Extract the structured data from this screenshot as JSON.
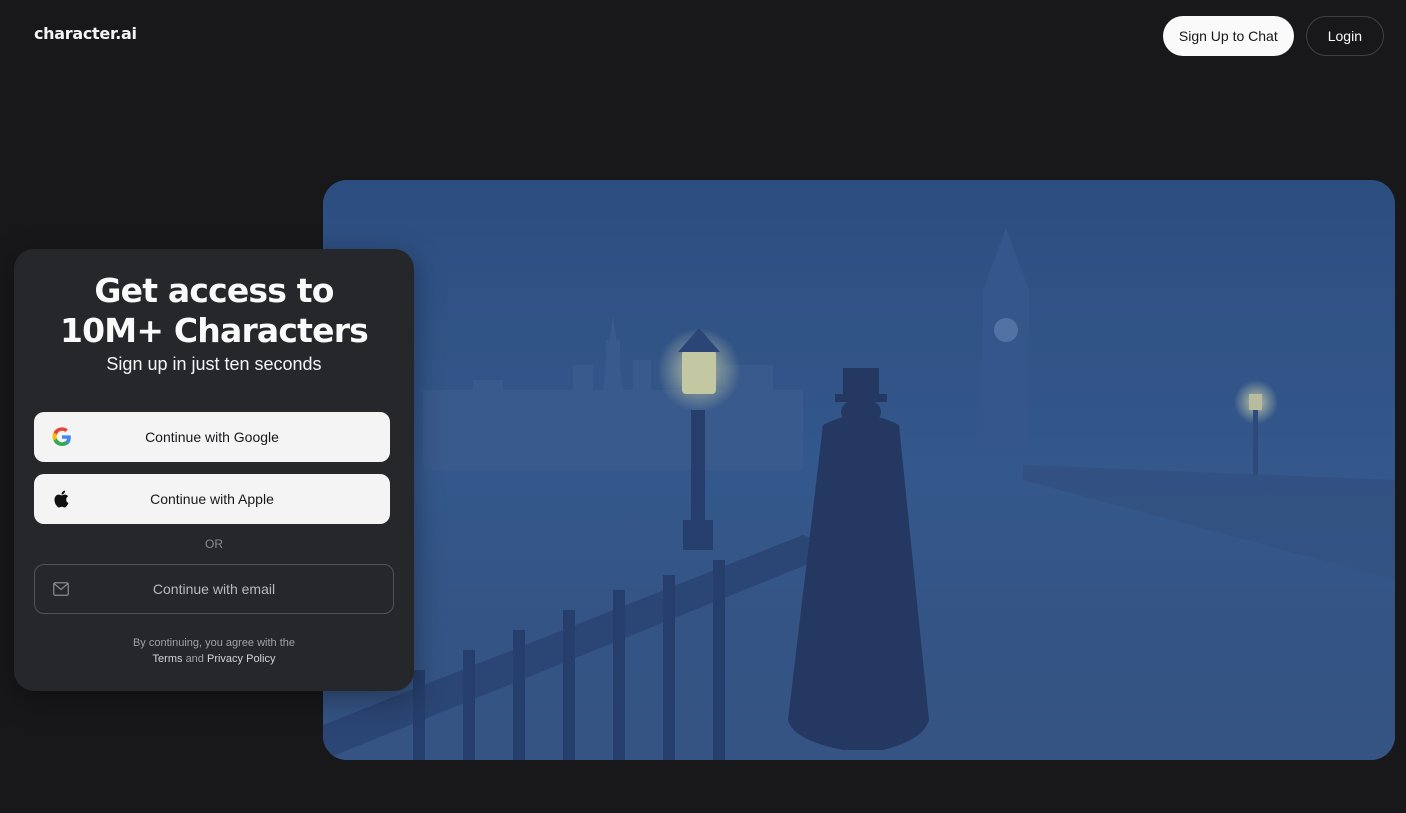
{
  "header": {
    "logo": "character.ai",
    "signup_label": "Sign Up to Chat",
    "login_label": "Login"
  },
  "panel": {
    "title_line1": "Get access to",
    "title_line2": "10M+ Characters",
    "subtitle": "Sign up in just ten seconds",
    "google_label": "Continue with Google",
    "apple_label": "Continue with Apple",
    "or_label": "OR",
    "email_label": "Continue with email",
    "legal_prefix": "By continuing, you agree with the",
    "terms_label": "Terms",
    "and_label": "and",
    "privacy_label": "Privacy Policy"
  },
  "hero": {
    "icon": "illustration-foggy-london-bridge"
  },
  "colors": {
    "background": "#18181b",
    "panel": "#26272b",
    "button_light": "#f4f4f5",
    "hero_blue": "#2c4a7a"
  }
}
